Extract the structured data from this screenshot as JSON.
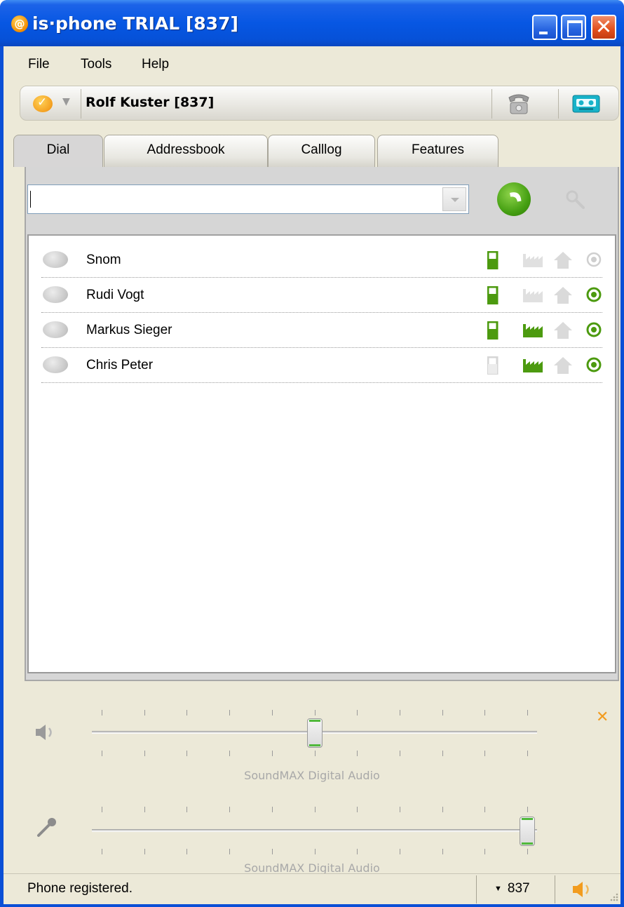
{
  "window": {
    "title": "is·phone TRIAL [837]",
    "app_icon": "at-sign-icon"
  },
  "menu": {
    "items": [
      {
        "label": "File"
      },
      {
        "label": "Tools"
      },
      {
        "label": "Help"
      }
    ]
  },
  "user_bar": {
    "status_icon": "presence-status-icon",
    "name": "Rolf Kuster [837]",
    "phone_icon": "phone-icon",
    "voicemail_icon": "tape-icon"
  },
  "tabs": [
    {
      "label": "Dial",
      "active": true
    },
    {
      "label": "Addressbook",
      "active": false
    },
    {
      "label": "Calllog",
      "active": false
    },
    {
      "label": "Features",
      "active": false
    }
  ],
  "dial": {
    "input_value": "",
    "call_icon": "call-icon",
    "search_icon": "search-icon"
  },
  "contacts": [
    {
      "name": "Snom",
      "mobile": true,
      "work": false,
      "home": false,
      "online": false
    },
    {
      "name": "Rudi Vogt",
      "mobile": true,
      "work": false,
      "home": false,
      "online": true
    },
    {
      "name": "Markus Sieger",
      "mobile": true,
      "work": true,
      "home": false,
      "online": true
    },
    {
      "name": "Chris Peter",
      "mobile": false,
      "work": true,
      "home": false,
      "online": true
    }
  ],
  "audio": {
    "speaker": {
      "device": "SoundMAX Digital Audio",
      "level": 0.5,
      "icon": "speaker-icon"
    },
    "microphone": {
      "device": "SoundMAX Digital Audio",
      "level": 1.0,
      "icon": "microphone-icon"
    },
    "close_icon": "close-icon"
  },
  "status_bar": {
    "text": "Phone registered.",
    "line": "837",
    "speaker_icon": "speaker-icon"
  },
  "colors": {
    "active_green": "#4c9a0f",
    "inactive_gray": "#d2d2d2",
    "accent_orange": "#f29c1f"
  }
}
